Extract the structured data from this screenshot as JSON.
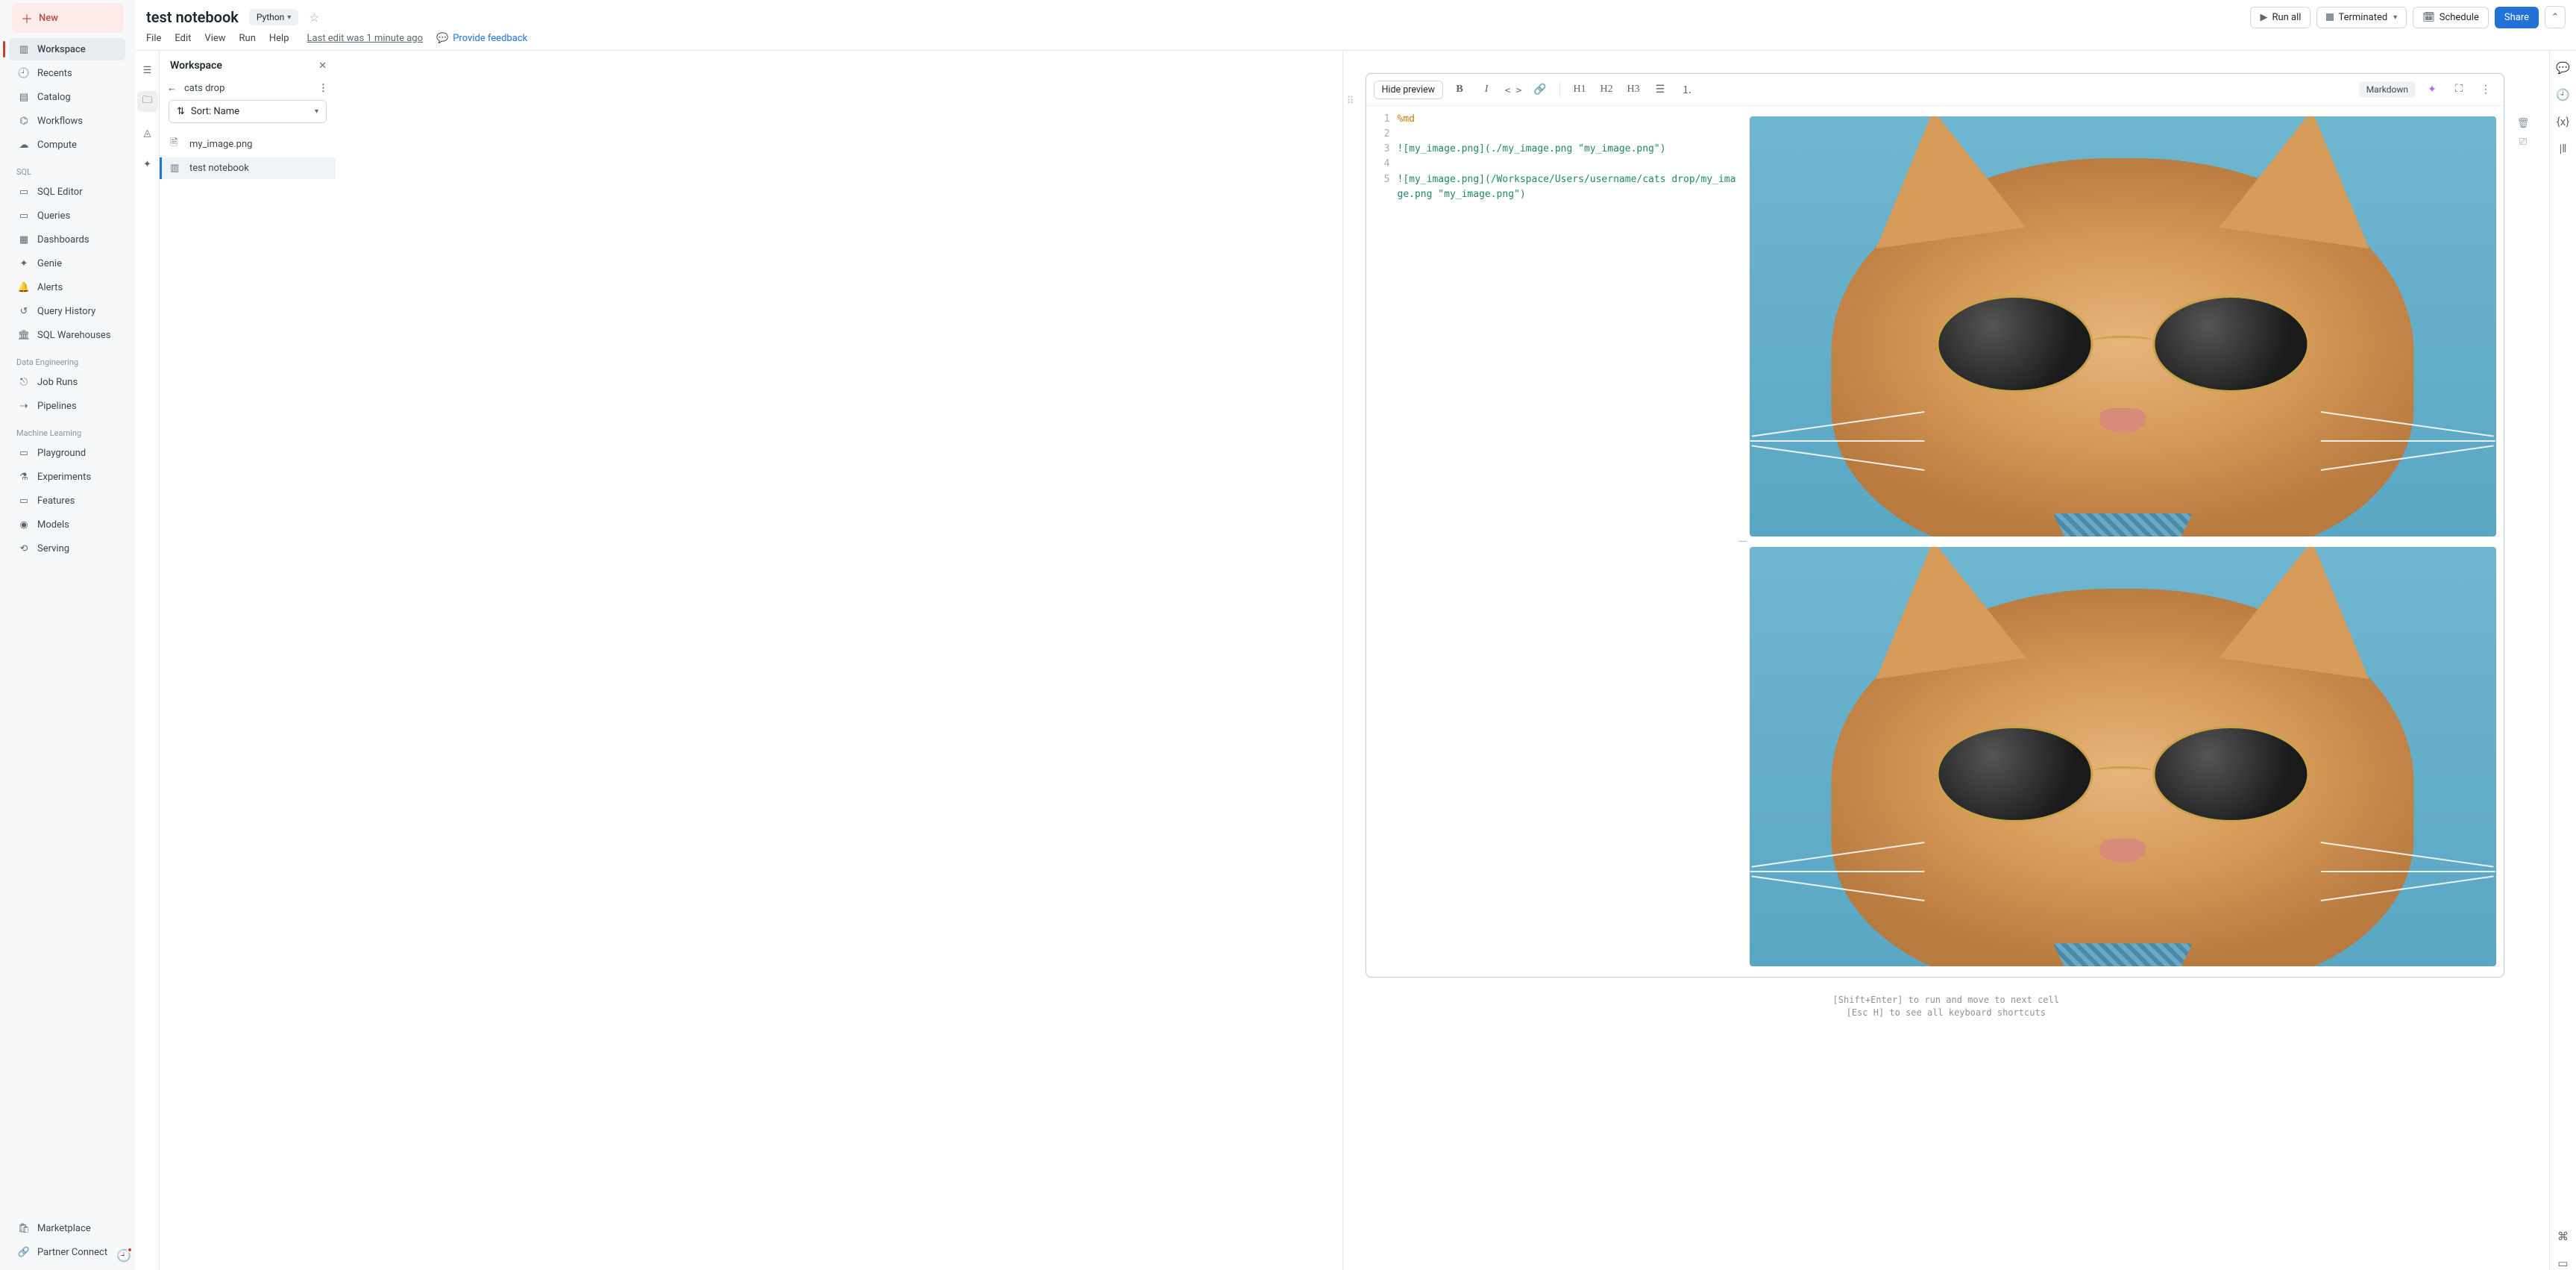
{
  "header": {
    "title": "test notebook",
    "language": "Python",
    "run_all": "Run all",
    "cluster_state": "Terminated",
    "schedule": "Schedule",
    "share": "Share"
  },
  "menu": {
    "file": "File",
    "edit": "Edit",
    "view": "View",
    "run": "Run",
    "help": "Help",
    "last_edit": "Last edit was 1 minute ago",
    "feedback": "Provide feedback"
  },
  "sidebar": {
    "new": "New",
    "main": [
      {
        "label": "Workspace",
        "icon": "workspace"
      },
      {
        "label": "Recents",
        "icon": "clock"
      },
      {
        "label": "Catalog",
        "icon": "catalog"
      },
      {
        "label": "Workflows",
        "icon": "workflow"
      },
      {
        "label": "Compute",
        "icon": "cloud"
      }
    ],
    "sql_label": "SQL",
    "sql": [
      {
        "label": "SQL Editor"
      },
      {
        "label": "Queries"
      },
      {
        "label": "Dashboards"
      },
      {
        "label": "Genie"
      },
      {
        "label": "Alerts"
      },
      {
        "label": "Query History"
      },
      {
        "label": "SQL Warehouses"
      }
    ],
    "de_label": "Data Engineering",
    "de": [
      {
        "label": "Job Runs"
      },
      {
        "label": "Pipelines"
      }
    ],
    "ml_label": "Machine Learning",
    "ml": [
      {
        "label": "Playground"
      },
      {
        "label": "Experiments"
      },
      {
        "label": "Features"
      },
      {
        "label": "Models"
      },
      {
        "label": "Serving"
      }
    ],
    "bottom": [
      {
        "label": "Marketplace"
      },
      {
        "label": "Partner Connect"
      }
    ]
  },
  "workspace_panel": {
    "title": "Workspace",
    "path": "cats drop",
    "sort": "Sort: Name",
    "files": [
      {
        "name": "my_image.png",
        "icon": "file"
      },
      {
        "name": "test notebook",
        "icon": "notebook"
      }
    ]
  },
  "cell": {
    "hide_preview": "Hide preview",
    "mode_label": "Markdown",
    "h1": "H1",
    "h2": "H2",
    "h3": "H3",
    "lines": {
      "1": "%md",
      "2": "",
      "3": "![my_image.png](./my_image.png \"my_image.png\")",
      "4": "",
      "5": "![my_image.png](/Workspace/Users/username/cats drop/my_image.png \"my_image.png\")"
    }
  },
  "hints": {
    "l1": "[Shift+Enter] to run and move to next cell",
    "l2": "[Esc H] to see all keyboard shortcuts"
  }
}
